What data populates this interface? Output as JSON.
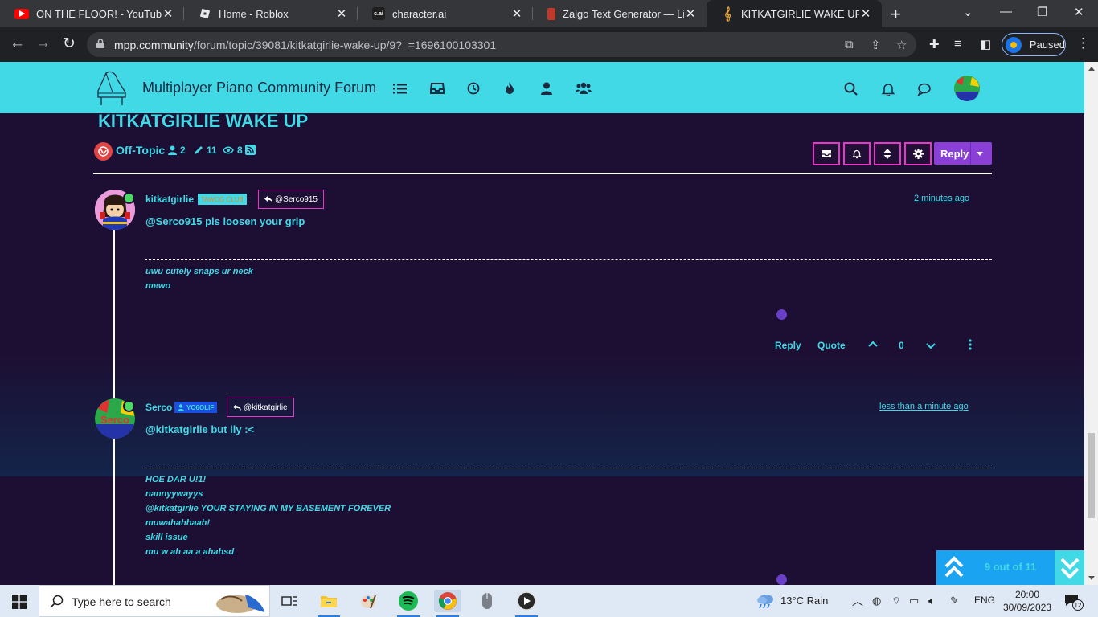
{
  "browser": {
    "tabs": [
      {
        "title": "ON THE FLOOR! - YouTube",
        "favicon": "youtube-icon"
      },
      {
        "title": "Home - Roblox",
        "favicon": "roblox-icon"
      },
      {
        "title": "character.ai",
        "favicon": "characterai-icon",
        "fav_text": "c.ai"
      },
      {
        "title": "Zalgo Text Generator — Ling",
        "favicon": "zalgo-icon"
      },
      {
        "title": "KITKATGIRLIE WAKE UP | mp",
        "favicon": "treble-clef-icon",
        "active": true
      }
    ],
    "url_host": "mpp.community",
    "url_path": "/forum/topic/39081/kitkatgirlie-wake-up/9?_=1696100103301",
    "profile_status": "Paused"
  },
  "site": {
    "title": "Multiplayer Piano Community Forum",
    "nav_icons": [
      "list-icon",
      "inbox-icon",
      "clock-icon",
      "fire-icon",
      "user-icon",
      "users-icon"
    ],
    "right_icons": [
      "search-icon",
      "bell-icon",
      "chat-icon"
    ],
    "colors": {
      "header": "#41d9e6",
      "accent": "#41d9e6",
      "button_border": "#e838c8",
      "reply": "#8a3fd6",
      "background": "#1c0f33"
    }
  },
  "topic": {
    "title": "KITKATGIRLIE WAKE UP",
    "category": "Off-Topic",
    "posters": "2",
    "posts": "11",
    "views": "8",
    "reply_label": "Reply"
  },
  "posts": [
    {
      "author": "kitkatgirlie",
      "group": "TAWOG CLUB",
      "parent": "@Serco915",
      "time": "2 minutes ago",
      "content": "@Serco915 pls loosen your grip",
      "signature": [
        "uwu cutely snaps ur neck",
        "mewo"
      ],
      "actions": {
        "reply": "Reply",
        "quote": "Quote",
        "votes": "0"
      }
    },
    {
      "author": "Serco",
      "group": "YO6OLIF",
      "parent": "@kitkatgirlie",
      "time": "less than a minute ago",
      "content": "@kitkatgirlie but ily :<",
      "avatar_text": "Serco",
      "signature": [
        "HOE DAR U!1!",
        "nannyywayys",
        "@kitkatgirlie YOUR STAYING IN MY BASEMENT FOREVER",
        "muwahahhaah!",
        "skill issue",
        "mu w ah aa a ahahsd"
      ]
    }
  ],
  "pagination": {
    "label": "9 out of 11"
  },
  "taskbar": {
    "search_placeholder": "Type here to search",
    "weather": "13°C  Rain",
    "language": "ENG",
    "time": "20:00",
    "date": "30/09/2023",
    "notifications": "12"
  }
}
